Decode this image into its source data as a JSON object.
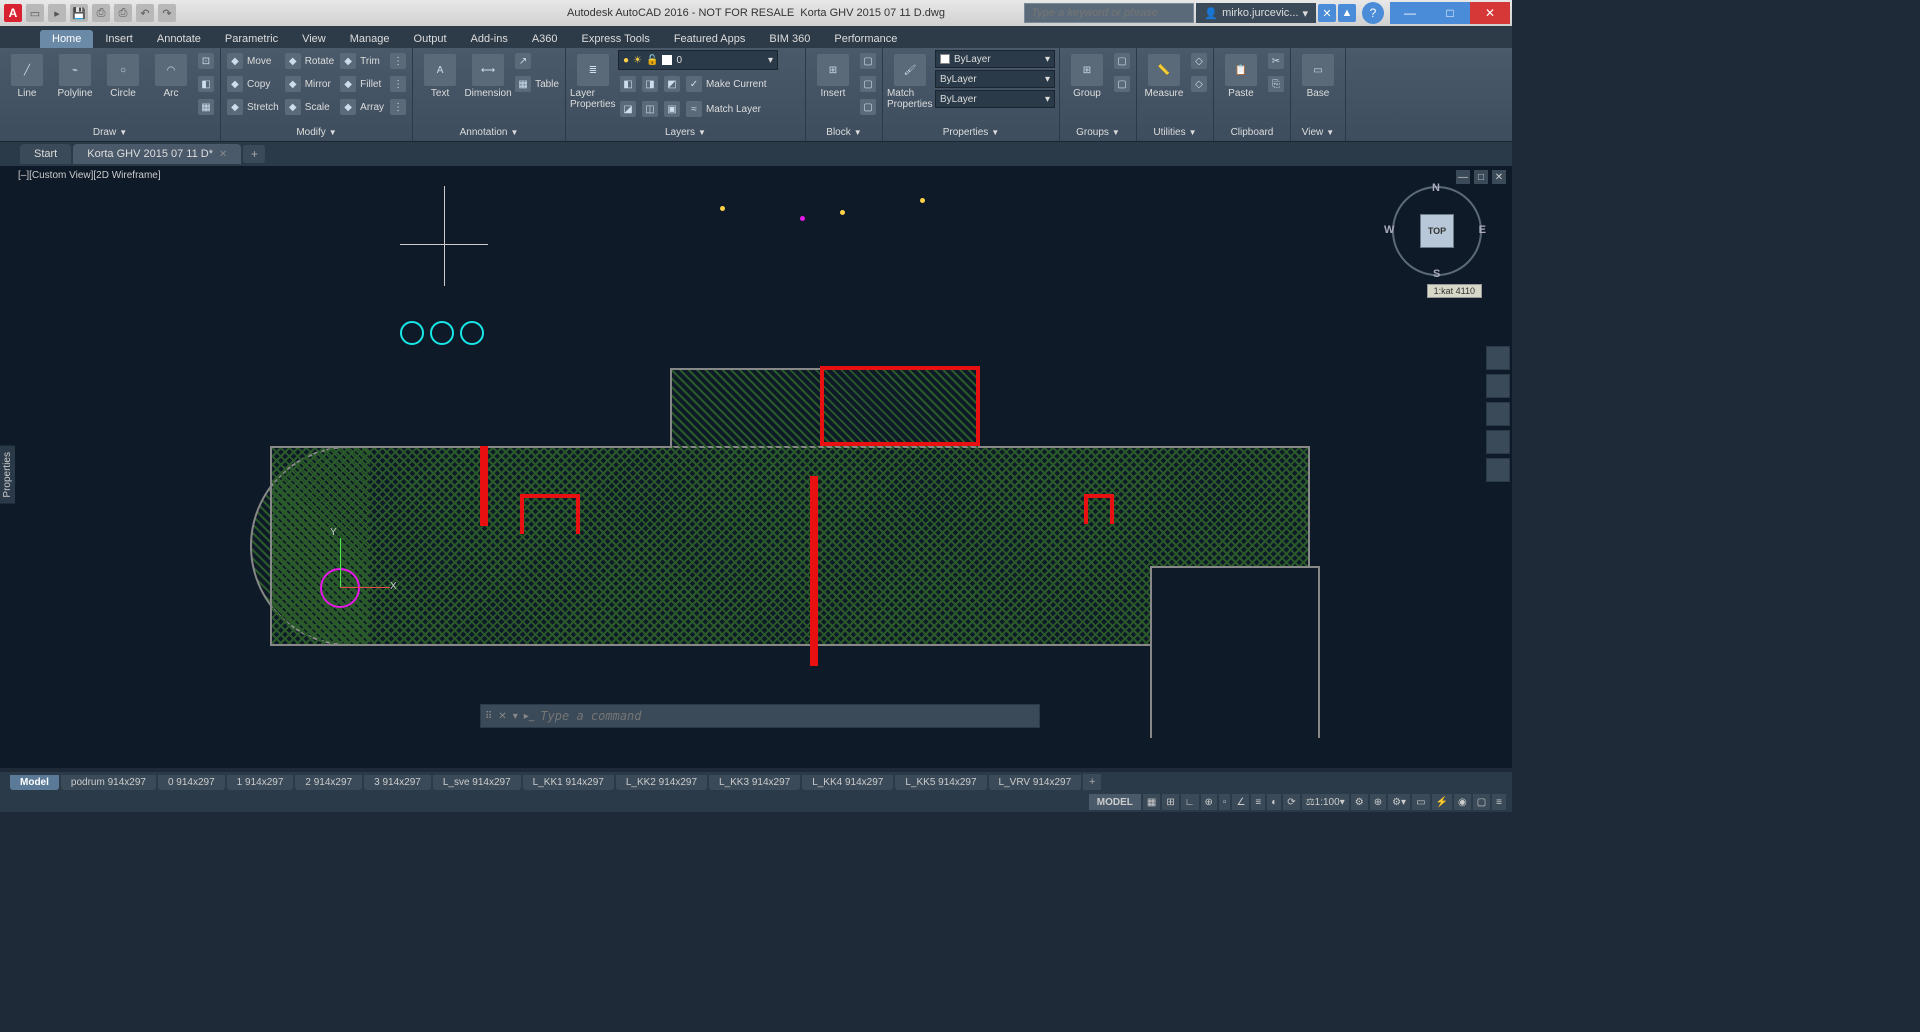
{
  "titlebar": {
    "app_logo": "A",
    "app_title_prefix": "Autodesk AutoCAD 2016 - NOT FOR RESALE",
    "doc_title": "Korta GHV 2015 07 11 D.dwg",
    "search_placeholder": "Type a keyword or phrase",
    "user_name": "mirko.jurcevic...",
    "help": "?"
  },
  "ribbon_tabs": [
    "Home",
    "Insert",
    "Annotate",
    "Parametric",
    "View",
    "Manage",
    "Output",
    "Add-ins",
    "A360",
    "Express Tools",
    "Featured Apps",
    "BIM 360",
    "Performance"
  ],
  "ribbon_active": 0,
  "panels": {
    "draw": {
      "title": "Draw",
      "big": [
        "Line",
        "Polyline",
        "Circle",
        "Arc"
      ]
    },
    "modify": {
      "title": "Modify",
      "rows": [
        [
          "Move",
          "Rotate",
          "Trim"
        ],
        [
          "Copy",
          "Mirror",
          "Fillet"
        ],
        [
          "Stretch",
          "Scale",
          "Array"
        ]
      ]
    },
    "annotation": {
      "title": "Annotation",
      "big": [
        "Text",
        "Dimension"
      ],
      "extra": "Table"
    },
    "layers": {
      "title": "Layers",
      "big": "Layer Properties",
      "combo_value": "0",
      "rows": [
        "Make Current",
        "Match Layer"
      ]
    },
    "block": {
      "title": "Block",
      "big": "Insert"
    },
    "properties": {
      "title": "Properties",
      "big": "Match Properties",
      "combos": [
        "ByLayer",
        "ByLayer",
        "ByLayer"
      ]
    },
    "groups": {
      "title": "Groups",
      "big": "Group"
    },
    "utilities": {
      "title": "Utilities",
      "big": "Measure"
    },
    "clipboard": {
      "title": "Clipboard",
      "big": "Paste"
    },
    "base": {
      "title": "View",
      "big": "Base"
    }
  },
  "filetabs": [
    {
      "label": "Start",
      "active": false
    },
    {
      "label": "Korta GHV 2015 07 11 D*",
      "active": true
    }
  ],
  "view_label": "[–][Custom View][2D Wireframe]",
  "properties_palette": "Properties",
  "viewcube": {
    "face": "TOP",
    "n": "N",
    "s": "S",
    "e": "E",
    "w": "W",
    "coord": "1:kat 4110"
  },
  "ucs": {
    "x": "X",
    "y": "Y"
  },
  "cmdline_placeholder": "Type a command",
  "layout_tabs": [
    "Model",
    "podrum 914x297",
    "0 914x297",
    "1 914x297",
    "2 914x297",
    "3 914x297",
    "L_sve 914x297",
    "L_KK1 914x297",
    "L_KK2 914x297",
    "L_KK3 914x297",
    "L_KK4 914x297",
    "L_KK5 914x297",
    "L_VRV 914x297"
  ],
  "layout_active": 0,
  "status": {
    "model": "MODEL",
    "scale": "1:100"
  }
}
